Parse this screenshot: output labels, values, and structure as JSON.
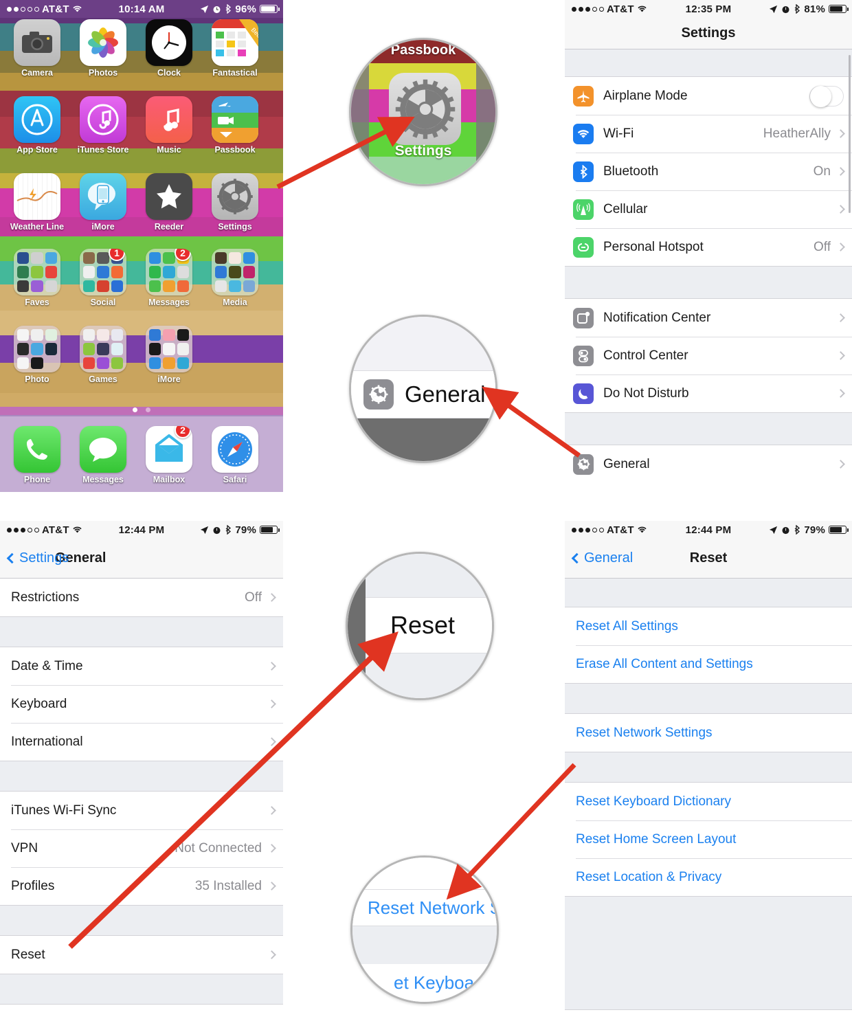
{
  "colors": {
    "ios_blue": "#1a80ef",
    "arrow_red": "#e03421",
    "badge_red": "#e82c2c",
    "group_bg": "#eceef2"
  },
  "homescreen": {
    "statusbar": {
      "carrier": "AT&T",
      "signal_filled": 2,
      "signal_total": 5,
      "wifi_icon": "wifi-icon",
      "time": "10:14 AM",
      "location_icon": "location-arrow-icon",
      "alarm_icon": "alarm-clock-icon",
      "bluetooth_icon": "bluetooth-icon",
      "battery": "96%"
    },
    "rows": [
      [
        {
          "label": "Camera",
          "icon": "camera-icon"
        },
        {
          "label": "Photos",
          "icon": "photos-icon"
        },
        {
          "label": "Clock",
          "icon": "clock-icon"
        },
        {
          "label": "Fantastical",
          "icon": "fantastical-icon"
        }
      ],
      [
        {
          "label": "App Store",
          "icon": "app-store-icon"
        },
        {
          "label": "iTunes Store",
          "icon": "itunes-store-icon"
        },
        {
          "label": "Music",
          "icon": "music-icon"
        },
        {
          "label": "Passbook",
          "icon": "passbook-icon"
        }
      ],
      [
        {
          "label": "Weather Line",
          "icon": "weather-line-icon"
        },
        {
          "label": "iMore",
          "icon": "imore-icon"
        },
        {
          "label": "Reeder",
          "icon": "reeder-icon"
        },
        {
          "label": "Settings",
          "icon": "settings-gear-icon"
        }
      ],
      [
        {
          "label": "Faves",
          "icon": "folder-icon",
          "badge": ""
        },
        {
          "label": "Social",
          "icon": "folder-icon",
          "badge": "1"
        },
        {
          "label": "Messages",
          "icon": "folder-icon",
          "badge": "2"
        },
        {
          "label": "Media",
          "icon": "folder-icon",
          "badge": ""
        }
      ],
      [
        {
          "label": "Photo",
          "icon": "folder-icon",
          "badge": ""
        },
        {
          "label": "Games",
          "icon": "folder-icon",
          "badge": ""
        },
        {
          "label": "iMore",
          "icon": "folder-icon",
          "badge": ""
        }
      ]
    ],
    "dock": [
      {
        "label": "Phone",
        "icon": "phone-icon",
        "badge": ""
      },
      {
        "label": "Messages",
        "icon": "messages-bubble-icon",
        "badge": ""
      },
      {
        "label": "Mailbox",
        "icon": "mailbox-icon",
        "badge": "2"
      },
      {
        "label": "Safari",
        "icon": "safari-compass-icon",
        "badge": ""
      }
    ],
    "page_dots": 2,
    "active_page": 1
  },
  "settings_screen": {
    "statusbar": {
      "carrier": "AT&T",
      "time": "12:35 PM",
      "battery": "81%"
    },
    "title": "Settings",
    "group1": [
      {
        "label": "Airplane Mode",
        "icon": "airplane-icon",
        "icon_color": "#f3922b",
        "control": "toggle",
        "value": ""
      },
      {
        "label": "Wi-Fi",
        "icon": "wifi-icon",
        "icon_color": "#1a7cf0",
        "control": "chevron",
        "value": "HeatherAlly"
      },
      {
        "label": "Bluetooth",
        "icon": "bluetooth-icon",
        "icon_color": "#1a7cf0",
        "control": "chevron",
        "value": "On"
      },
      {
        "label": "Cellular",
        "icon": "cellular-antenna-icon",
        "icon_color": "#4cd469",
        "control": "chevron",
        "value": ""
      },
      {
        "label": "Personal Hotspot",
        "icon": "hotspot-link-icon",
        "icon_color": "#4cd469",
        "control": "chevron",
        "value": "Off"
      }
    ],
    "group2": [
      {
        "label": "Notification Center",
        "icon": "notification-center-icon",
        "icon_color": "#8e8e93",
        "control": "chevron",
        "value": ""
      },
      {
        "label": "Control Center",
        "icon": "control-center-icon",
        "icon_color": "#8e8e93",
        "control": "chevron",
        "value": ""
      },
      {
        "label": "Do Not Disturb",
        "icon": "moon-icon",
        "icon_color": "#5856d6",
        "control": "chevron",
        "value": ""
      }
    ],
    "group3": [
      {
        "label": "General",
        "icon": "settings-gear-icon",
        "icon_color": "#8e8e93",
        "control": "chevron",
        "value": ""
      }
    ]
  },
  "general_screen": {
    "statusbar": {
      "carrier": "AT&T",
      "time": "12:44 PM",
      "battery": "79%"
    },
    "back_label": "Settings",
    "title": "General",
    "group1": [
      {
        "label": "Restrictions",
        "value": "Off"
      }
    ],
    "group2": [
      {
        "label": "Date & Time",
        "value": ""
      },
      {
        "label": "Keyboard",
        "value": ""
      },
      {
        "label": "International",
        "value": ""
      }
    ],
    "group3": [
      {
        "label": "iTunes Wi-Fi Sync",
        "value": ""
      },
      {
        "label": "VPN",
        "value": "Not Connected"
      },
      {
        "label": "Profiles",
        "value": "35 Installed"
      }
    ],
    "group4": [
      {
        "label": "Reset",
        "value": ""
      }
    ]
  },
  "reset_screen": {
    "statusbar": {
      "carrier": "AT&T",
      "time": "12:44 PM",
      "battery": "79%"
    },
    "back_label": "General",
    "title": "Reset",
    "group1": [
      {
        "label": "Reset All Settings"
      },
      {
        "label": "Erase All Content and Settings"
      }
    ],
    "group2": [
      {
        "label": "Reset Network Settings"
      }
    ],
    "group3": [
      {
        "label": "Reset Keyboard Dictionary"
      },
      {
        "label": "Reset Home Screen Layout"
      },
      {
        "label": "Reset Location & Privacy"
      }
    ]
  },
  "callouts": {
    "settings_icon": {
      "label_top": "Passbook",
      "label_bottom": "Settings",
      "icon": "settings-gear-icon"
    },
    "general_row": {
      "label": "General",
      "icon": "settings-gear-icon"
    },
    "reset_row": {
      "label": "Reset"
    },
    "reset_network_row": {
      "label": "Reset Network Sett",
      "label_partial": "et Keyboa"
    }
  }
}
